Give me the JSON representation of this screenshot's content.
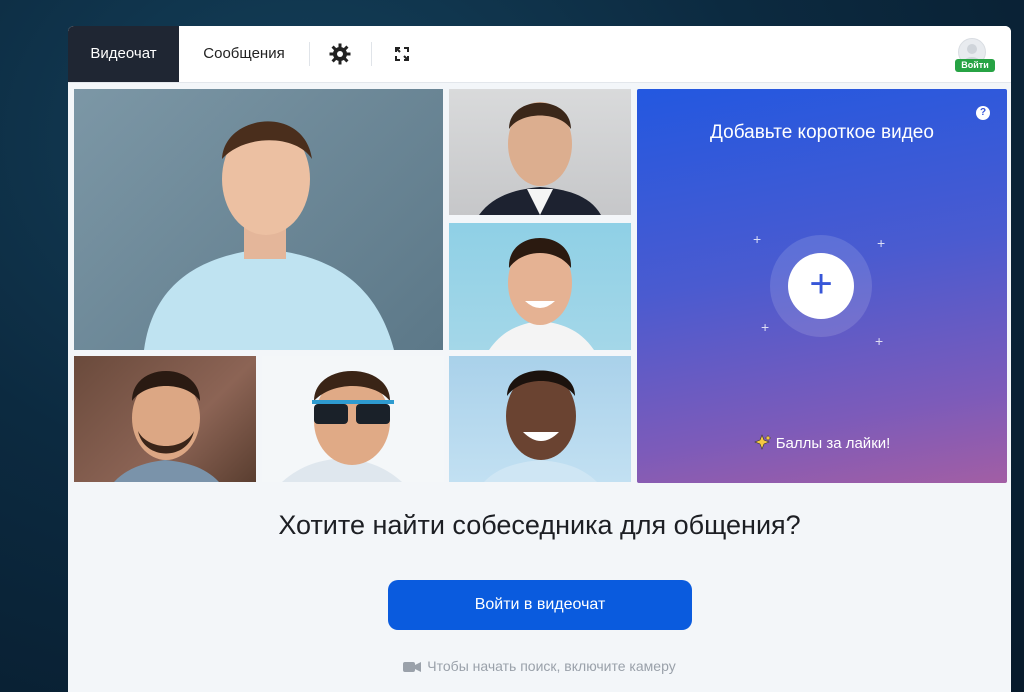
{
  "tabs": {
    "videochat": "Видеочат",
    "messages": "Сообщения"
  },
  "toolbar": {
    "settings_icon": "gear-icon",
    "fullscreen_icon": "expand-icon",
    "login_badge": "Войти"
  },
  "promo": {
    "title": "Добавьте короткое видео",
    "help": "?",
    "footer": "Баллы за лайки!",
    "gradient": [
      "#2358e0",
      "#a25ea4"
    ]
  },
  "main": {
    "headline": "Хотите найти собеседника для общения?",
    "cta": "Войти в видеочат",
    "hint": "Чтобы начать поиск, включите камеру"
  },
  "colors": {
    "accent": "#0a5bde",
    "tab_active_bg": "#1f2633",
    "badge": "#27a344"
  }
}
